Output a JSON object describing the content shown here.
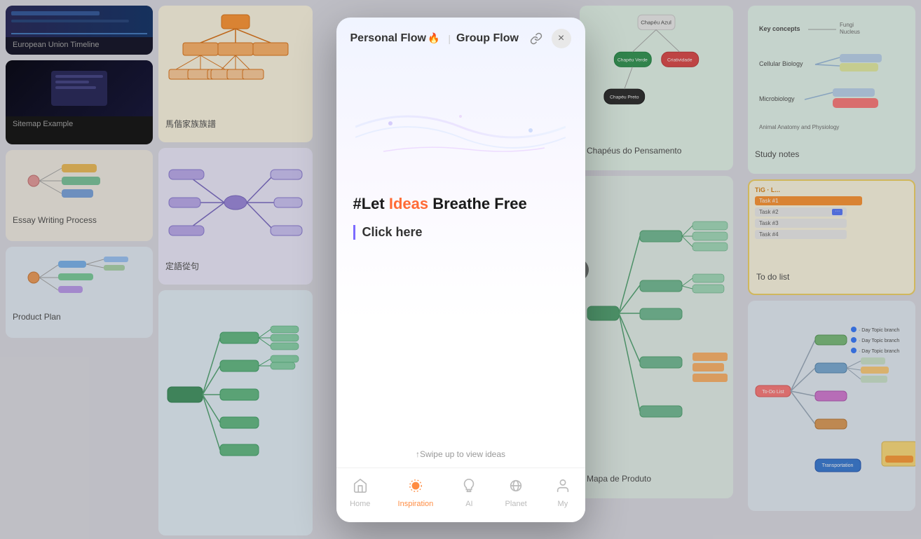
{
  "modal": {
    "tab1": {
      "label": "Personal Flow",
      "emoji": "🔥"
    },
    "tab2": {
      "label": "Group Flow"
    },
    "headline": "#Let Ideas Breathe Free",
    "headline_let": "#Let ",
    "headline_ideas": "Ideas",
    "headline_rest": " Breathe Free",
    "cta": "Click here",
    "swipe_hint": "↑Swipe up to view ideas"
  },
  "nav": {
    "items": [
      {
        "label": "Home",
        "icon": "⌂",
        "active": false
      },
      {
        "label": "Inspiration",
        "icon": "◉",
        "active": true
      },
      {
        "label": "AI",
        "icon": "◎",
        "active": false
      },
      {
        "label": "Planet",
        "icon": "⊕",
        "active": false
      },
      {
        "label": "My",
        "icon": "👤",
        "active": false
      }
    ]
  },
  "bg_cards": {
    "col1": [
      {
        "title": "European Union Timeline",
        "type": "dark"
      },
      {
        "title": "",
        "type": "dark2"
      },
      {
        "title": "Sitemap Example",
        "type": "light"
      }
    ],
    "col2": [
      {
        "title": "馬偕家族族譜",
        "type": "orange"
      },
      {
        "title": "定語從句",
        "type": "purple"
      },
      {
        "title": "",
        "type": "blue"
      }
    ],
    "col3": [
      {
        "title": "Essay Writing Process",
        "type": "blue-light"
      },
      {
        "title": "Product Plan",
        "type": "blue-light2"
      },
      {
        "title": "",
        "type": "light3"
      }
    ],
    "right1": [
      {
        "title": "Chapéus do Pensamento",
        "type": "green"
      },
      {
        "title": "Mapa de Produto",
        "type": "teal"
      }
    ],
    "right2": [
      {
        "title": "Study notes",
        "type": "white"
      },
      {
        "title": "To do list",
        "type": "yellow"
      },
      {
        "title": "",
        "type": "pink"
      }
    ]
  },
  "colors": {
    "accent": "#ff8c42",
    "tab_active": "#333333",
    "cta_border": "#7c6bff",
    "headline_color": "#ff6b35"
  }
}
